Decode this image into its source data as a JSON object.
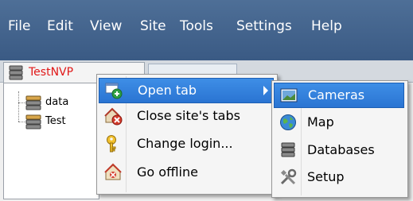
{
  "menubar": {
    "items": [
      {
        "label": "File",
        "key": "file"
      },
      {
        "label": "Edit",
        "key": "edit"
      },
      {
        "label": "View",
        "key": "view"
      },
      {
        "label": "Site",
        "key": "site"
      },
      {
        "label": "Tools",
        "key": "tools"
      },
      {
        "label": "Settings",
        "key": "settings"
      },
      {
        "label": "Help",
        "key": "help"
      }
    ]
  },
  "site_tab": {
    "label": "TestNVP",
    "color": "#e01818"
  },
  "tree": {
    "items": [
      {
        "label": "data"
      },
      {
        "label": "Test"
      }
    ]
  },
  "context_menu": {
    "items": [
      {
        "label": "Open tab",
        "icon": "open-tab-icon",
        "highlighted": true,
        "has_submenu": true
      },
      {
        "label": "Close site's tabs",
        "icon": "close-tabs-icon"
      },
      {
        "label": "Change login...",
        "icon": "key-icon"
      },
      {
        "label": "Go offline",
        "icon": "go-offline-icon"
      }
    ]
  },
  "submenu": {
    "items": [
      {
        "label": "Cameras",
        "icon": "cameras-icon",
        "highlighted": true
      },
      {
        "label": "Map",
        "icon": "globe-icon"
      },
      {
        "label": "Databases",
        "icon": "database-icon"
      },
      {
        "label": "Setup",
        "icon": "tools-icon"
      }
    ]
  },
  "colors": {
    "menubar": "#3a5a84",
    "highlight": "#2a74d2"
  }
}
